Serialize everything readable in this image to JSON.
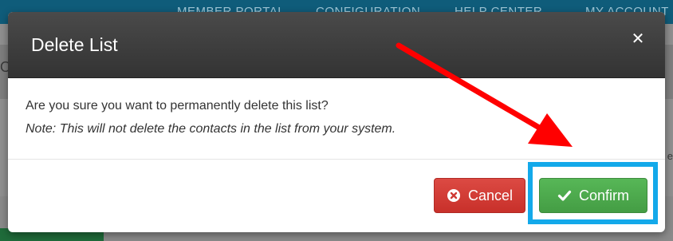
{
  "background": {
    "nav": {
      "items": [
        "MEMBER PORTAL",
        "CONFIGURATION",
        "HELP CENTER",
        "MY ACCOUNT"
      ]
    },
    "left_fragment": "O",
    "right_fragment": "e"
  },
  "modal": {
    "title": "Delete List",
    "close_symbol": "✕",
    "body": {
      "question": "Are you sure you want to permanently delete this list?",
      "note": "Note: This will not delete the contacts in the list from your system."
    },
    "footer": {
      "cancel_label": "Cancel",
      "confirm_label": "Confirm"
    }
  },
  "icons": {
    "close": "close-icon",
    "cancel": "times-circle-icon",
    "confirm": "checkmark-icon"
  },
  "colors": {
    "header_bg": "#3c3c3c",
    "cancel": "#d43f3a",
    "confirm": "#4cae4c",
    "highlight": "#13a9ea",
    "arrow": "#ff0000"
  }
}
